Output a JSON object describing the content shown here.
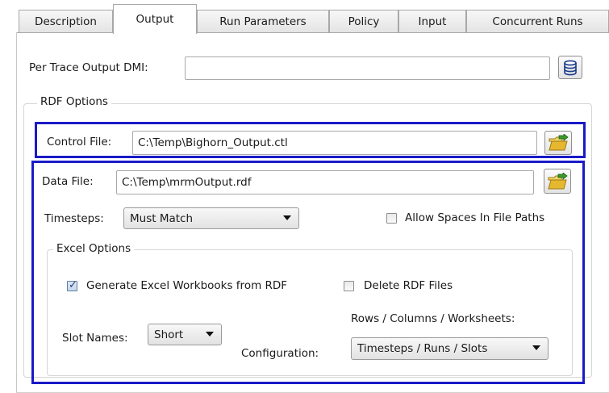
{
  "tabs": [
    {
      "label": "Description",
      "active": false
    },
    {
      "label": "Output",
      "active": true
    },
    {
      "label": "Run Parameters",
      "active": false
    },
    {
      "label": "Policy",
      "active": false
    },
    {
      "label": "Input",
      "active": false
    },
    {
      "label": "Concurrent Runs",
      "active": false
    }
  ],
  "per_trace": {
    "label": "Per Trace Output DMI:",
    "value": ""
  },
  "rdf_options": {
    "title": "RDF Options",
    "control_file": {
      "label": "Control File:",
      "value": "C:\\Temp\\Bighorn_Output.ctl"
    },
    "data_file": {
      "label": "Data File:",
      "value": "C:\\Temp\\mrmOutput.rdf"
    },
    "timesteps": {
      "label": "Timesteps:",
      "selected": "Must Match"
    },
    "allow_spaces": {
      "label": "Allow Spaces In File Paths",
      "checked": false
    }
  },
  "excel_options": {
    "title": "Excel Options",
    "generate_workbooks": {
      "label": "Generate Excel Workbooks from RDF",
      "checked": true
    },
    "delete_rdf": {
      "label": "Delete RDF Files",
      "checked": false
    },
    "slot_names": {
      "label": "Slot Names:",
      "selected": "Short"
    },
    "configuration": {
      "label": "Configuration:",
      "header": "Rows / Columns / Worksheets:",
      "selected": "Timesteps / Runs / Slots"
    }
  },
  "colors": {
    "highlight": "#1a1ac8",
    "folder_icon": "#e6b830",
    "arrow_icon": "#3a9a2a"
  }
}
